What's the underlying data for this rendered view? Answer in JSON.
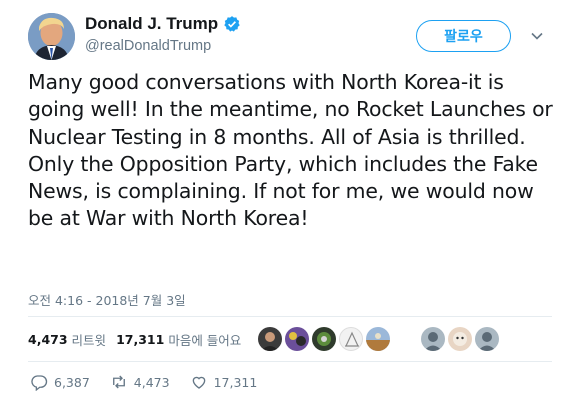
{
  "user": {
    "display_name": "Donald J. Trump",
    "handle": "@realDonaldTrump",
    "verified": true,
    "verified_icon": "verified-badge-icon"
  },
  "header": {
    "follow_label": "팔로우",
    "menu_icon": "chevron-down-icon"
  },
  "tweet": {
    "text": "Many good conversations with North Korea-it is going well! In the meantime, no Rocket Launches or Nuclear Testing in 8 months. All of Asia is thrilled. Only the Opposition Party, which includes the Fake News, is complaining. If not for me, we would now be at War with North Korea!",
    "timestamp": "오전 4:16 - 2018년 7월 3일"
  },
  "stats": {
    "retweets_count": "4,473",
    "retweets_label": "리트윗",
    "likes_count": "17,311",
    "likes_label": "마음에 들어요"
  },
  "actions": {
    "reply_count": "6,387",
    "retweet_count": "4,473",
    "like_count": "17,311"
  },
  "colors": {
    "accent": "#1da1f2",
    "text": "#14171a",
    "muted": "#657786"
  }
}
